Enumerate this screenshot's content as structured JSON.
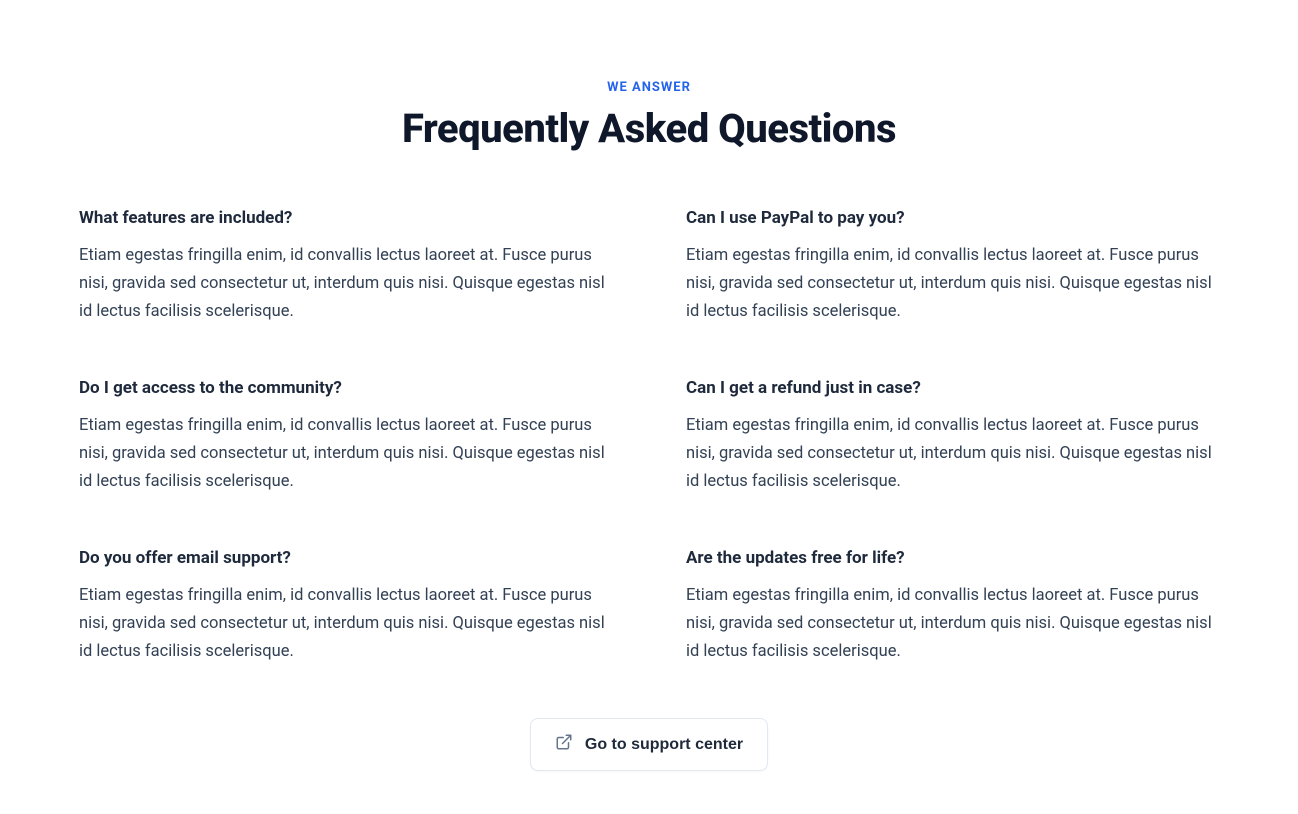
{
  "header": {
    "eyebrow": "WE ANSWER",
    "title": "Frequently Asked Questions"
  },
  "faq": [
    {
      "question": "What features are included?",
      "answer": "Etiam egestas fringilla enim, id convallis lectus laoreet at. Fusce purus nisi, gravida sed consectetur ut, interdum quis nisi. Quisque egestas nisl id lectus facilisis scelerisque."
    },
    {
      "question": "Can I use PayPal to pay you?",
      "answer": "Etiam egestas fringilla enim, id convallis lectus laoreet at. Fusce purus nisi, gravida sed consectetur ut, interdum quis nisi. Quisque egestas nisl id lectus facilisis scelerisque."
    },
    {
      "question": "Do I get access to the community?",
      "answer": "Etiam egestas fringilla enim, id convallis lectus laoreet at. Fusce purus nisi, gravida sed consectetur ut, interdum quis nisi. Quisque egestas nisl id lectus facilisis scelerisque."
    },
    {
      "question": "Can I get a refund just in case?",
      "answer": "Etiam egestas fringilla enim, id convallis lectus laoreet at. Fusce purus nisi, gravida sed consectetur ut, interdum quis nisi. Quisque egestas nisl id lectus facilisis scelerisque."
    },
    {
      "question": "Do you offer email support?",
      "answer": "Etiam egestas fringilla enim, id convallis lectus laoreet at. Fusce purus nisi, gravida sed consectetur ut, interdum quis nisi. Quisque egestas nisl id lectus facilisis scelerisque."
    },
    {
      "question": "Are the updates free for life?",
      "answer": "Etiam egestas fringilla enim, id convallis lectus laoreet at. Fusce purus nisi, gravida sed consectetur ut, interdum quis nisi. Quisque egestas nisl id lectus facilisis scelerisque."
    }
  ],
  "cta": {
    "label": "Go to support center"
  }
}
